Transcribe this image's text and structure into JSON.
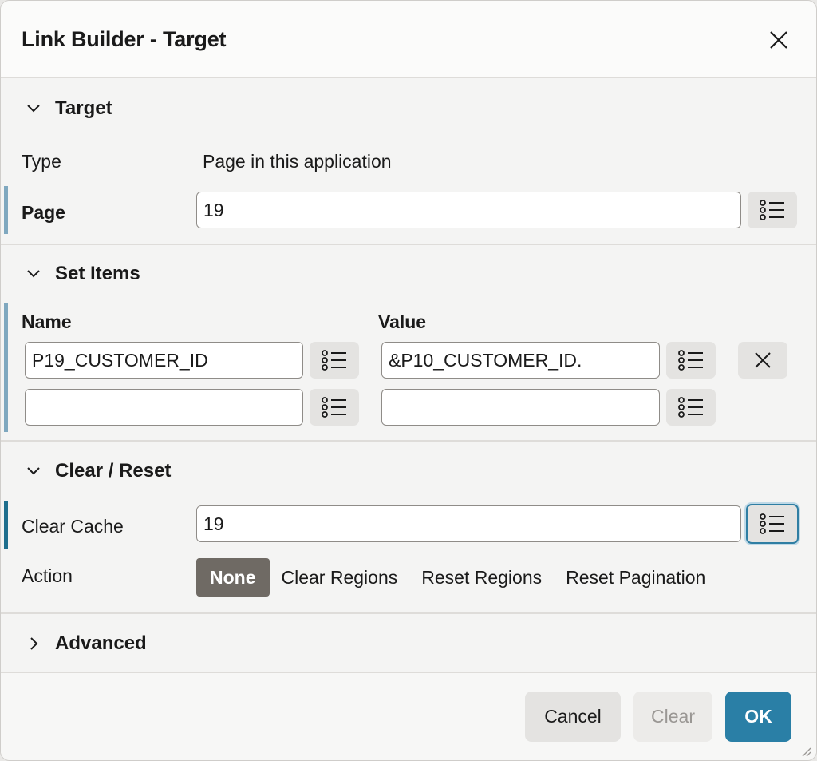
{
  "dialog": {
    "title": "Link Builder - Target"
  },
  "target": {
    "heading": "Target",
    "type_label": "Type",
    "type_value": "Page in this application",
    "page_label": "Page",
    "page_value": "19"
  },
  "set_items": {
    "heading": "Set Items",
    "name_header": "Name",
    "value_header": "Value",
    "rows": [
      {
        "name": "P19_CUSTOMER_ID",
        "value": "&P10_CUSTOMER_ID."
      },
      {
        "name": "",
        "value": ""
      }
    ]
  },
  "clear_reset": {
    "heading": "Clear / Reset",
    "clear_cache_label": "Clear Cache",
    "clear_cache_value": "19",
    "action_label": "Action",
    "actions": [
      "None",
      "Clear Regions",
      "Reset Regions",
      "Reset Pagination"
    ],
    "selected_action": "None"
  },
  "advanced": {
    "heading": "Advanced"
  },
  "footer": {
    "cancel": "Cancel",
    "clear": "Clear",
    "ok": "OK"
  },
  "icons": {
    "close": "close-icon",
    "section_expanded": "chevron-down-icon",
    "section_collapsed": "chevron-right-icon",
    "list": "list-icon",
    "remove": "remove-icon"
  },
  "colors": {
    "accent": "#2a7fa6",
    "selected_radio": "#6f6a64",
    "required_marker": "#7fa8bf"
  }
}
